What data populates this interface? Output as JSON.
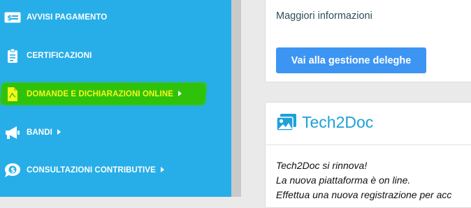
{
  "sidebar": {
    "items": [
      {
        "label": "AVVISI PAGAMENTO",
        "icon": "money-bill-icon",
        "has_caret": false
      },
      {
        "label": "CERTIFICAZIONI",
        "icon": "clipboard-icon",
        "has_caret": false
      },
      {
        "label": "DOMANDE E DICHIARAZIONI ONLINE",
        "icon": "pdf-file-icon",
        "has_caret": true,
        "highlighted": true
      },
      {
        "label": "BANDI",
        "icon": "megaphone-icon",
        "has_caret": true
      },
      {
        "label": "CONSULTAZIONI CONTRIBUTIVE",
        "icon": "coin-chat-icon",
        "has_caret": true
      }
    ],
    "colors": {
      "background": "#27aee8",
      "highlight": "#2fc20a",
      "highlight_text": "#f4f81b"
    }
  },
  "main": {
    "deleghe_card": {
      "more_info": "Maggiori informazioni",
      "button_label": "Vai alla gestione deleghe"
    },
    "tech2doc_card": {
      "title": "Tech2Doc",
      "icon": "image-gallery-icon",
      "lines": [
        "Tech2Doc si rinnova!",
        "La nuova piattaforma è on line.",
        "Effettua una nuova registrazione per acc"
      ]
    },
    "colors": {
      "button": "#3d95f3",
      "title": "#1ea1d9"
    }
  }
}
